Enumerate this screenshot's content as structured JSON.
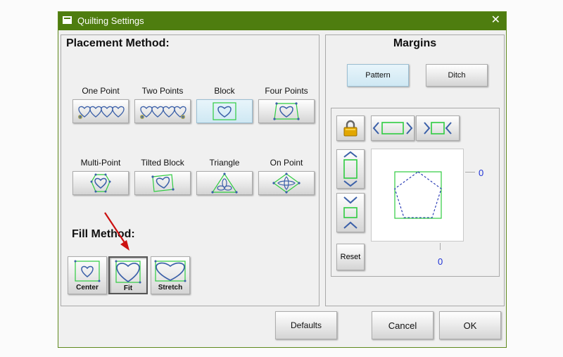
{
  "window": {
    "title": "Quilting Settings",
    "close_symbol": "✕"
  },
  "placement": {
    "heading": "Placement Method:",
    "methods": [
      {
        "label": "One Point"
      },
      {
        "label": "Two Points"
      },
      {
        "label": "Block"
      },
      {
        "label": "Four Points"
      },
      {
        "label": "Multi-Point"
      },
      {
        "label": "Tilted Block"
      },
      {
        "label": "Triangle"
      },
      {
        "label": "On Point"
      }
    ],
    "selected": "Block"
  },
  "fill": {
    "heading": "Fill Method:",
    "methods": [
      {
        "label": "Center"
      },
      {
        "label": "Fit"
      },
      {
        "label": "Stretch"
      }
    ],
    "selected": "Fit"
  },
  "margins": {
    "heading": "Margins",
    "pattern_label": "Pattern",
    "ditch_label": "Ditch",
    "selected_tab": "Pattern",
    "reset_label": "Reset",
    "right_value": "0",
    "bottom_value": "0"
  },
  "footer": {
    "defaults_label": "Defaults",
    "cancel_label": "Cancel",
    "ok_label": "OK"
  },
  "colors": {
    "titlebar": "#4e7d0f",
    "shape_blue": "#3a5fa8",
    "shape_green": "#2ecc40",
    "value_blue": "#1f33d6",
    "arrow_red": "#cc1111"
  }
}
